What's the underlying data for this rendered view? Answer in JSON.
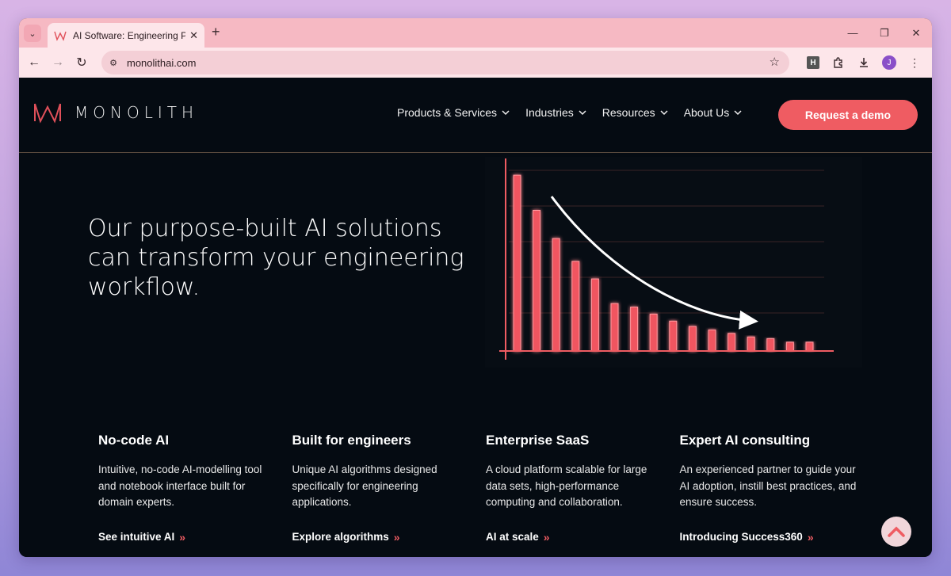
{
  "browser": {
    "tab_title": "AI Software: Engineering Produ",
    "url": "monolithai.com",
    "extension_letter": "H",
    "avatar_letter": "J"
  },
  "site": {
    "logo_text": "MONOLITH",
    "nav": [
      {
        "label": "Products & Services"
      },
      {
        "label": "Industries"
      },
      {
        "label": "Resources"
      },
      {
        "label": "About Us"
      }
    ],
    "cta_label": "Request a demo",
    "hero_text": "Our purpose-built AI solutions can transform your engineering workflow."
  },
  "features": [
    {
      "title": "No-code AI",
      "desc": "Intuitive, no-code AI-modelling tool and notebook interface built for domain experts.",
      "link": "See intuitive AI"
    },
    {
      "title": "Built for engineers",
      "desc": "Unique AI algorithms designed specifically for engineering applications.",
      "link": "Explore algorithms"
    },
    {
      "title": "Enterprise SaaS",
      "desc": "A cloud platform scalable for large data sets, high-performance computing and collaboration.",
      "link": "AI at scale"
    },
    {
      "title": "Expert AI consulting",
      "desc": "An experienced partner to guide your AI adoption, instill best practices, and ensure success.",
      "link": "Introducing Success360"
    }
  ],
  "colors": {
    "accent": "#ef5c62",
    "page_bg": "#050b12",
    "tab_strip": "#f6b9c3"
  },
  "chart_data": {
    "type": "bar",
    "values": [
      100,
      80,
      64,
      51,
      41,
      27,
      25,
      21,
      17,
      14,
      12,
      10,
      8,
      7,
      5,
      5
    ],
    "ylim": [
      0,
      105
    ],
    "annotation": "decreasing trend arrow"
  }
}
